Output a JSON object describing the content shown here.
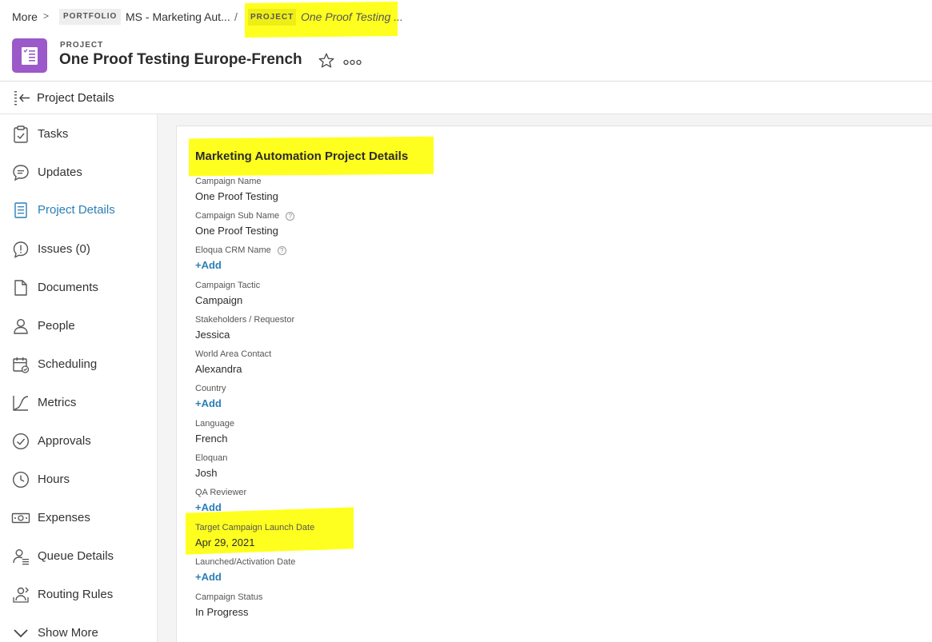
{
  "breadcrumb": {
    "more": "More",
    "separator": ">",
    "portfolio_tag": "PORTFOLIO",
    "portfolio_name": "MS - Marketing Aut...",
    "slash": "/",
    "project_tag": "PROJECT",
    "project_name": "One Proof Testing ..."
  },
  "header": {
    "type_label": "PROJECT",
    "title": "One Proof Testing Europe-French",
    "icon": "project-document-icon",
    "icon_color": "#9b59c9"
  },
  "subheader": {
    "title": "Project Details"
  },
  "sidebar": {
    "items": [
      {
        "label": "Tasks",
        "icon": "tasks-icon"
      },
      {
        "label": "Updates",
        "icon": "updates-icon"
      },
      {
        "label": "Project Details",
        "icon": "details-icon",
        "active": true
      },
      {
        "label": "Issues (0)",
        "icon": "issues-icon"
      },
      {
        "label": "Documents",
        "icon": "documents-icon"
      },
      {
        "label": "People",
        "icon": "people-icon"
      },
      {
        "label": "Scheduling",
        "icon": "scheduling-icon"
      },
      {
        "label": "Metrics",
        "icon": "metrics-icon"
      },
      {
        "label": "Approvals",
        "icon": "approvals-icon"
      },
      {
        "label": "Hours",
        "icon": "hours-icon"
      },
      {
        "label": "Expenses",
        "icon": "expenses-icon"
      },
      {
        "label": "Queue Details",
        "icon": "queue-icon"
      },
      {
        "label": "Routing Rules",
        "icon": "routing-icon"
      },
      {
        "label": "Show More",
        "icon": "chevron-down-icon"
      }
    ]
  },
  "section": {
    "title": "Marketing Automation Project Details",
    "add_label": "+Add",
    "fields": [
      {
        "label": "Campaign Name",
        "value": "One Proof Testing"
      },
      {
        "label": "Campaign Sub Name",
        "value": "One Proof Testing",
        "help": "?"
      },
      {
        "label": "Eloqua CRM Name",
        "value": null,
        "help": "?"
      },
      {
        "label": "Campaign Tactic",
        "value": "Campaign"
      },
      {
        "label": "Stakeholders / Requestor",
        "value": "Jessica"
      },
      {
        "label": "World Area Contact",
        "value": "Alexandra"
      },
      {
        "label": "Country",
        "value": null
      },
      {
        "label": "Language",
        "value": "French"
      },
      {
        "label": "Eloquan",
        "value": "Josh"
      },
      {
        "label": "QA Reviewer",
        "value": null
      },
      {
        "label": "Target Campaign Launch Date",
        "value": "Apr 29, 2021"
      },
      {
        "label": "Launched/Activation Date",
        "value": null
      },
      {
        "label": "Campaign Status",
        "value": "In Progress"
      }
    ]
  },
  "colors": {
    "accent": "#2a7fb8",
    "highlight": "#ffff1f",
    "project_icon": "#9b59c9"
  }
}
